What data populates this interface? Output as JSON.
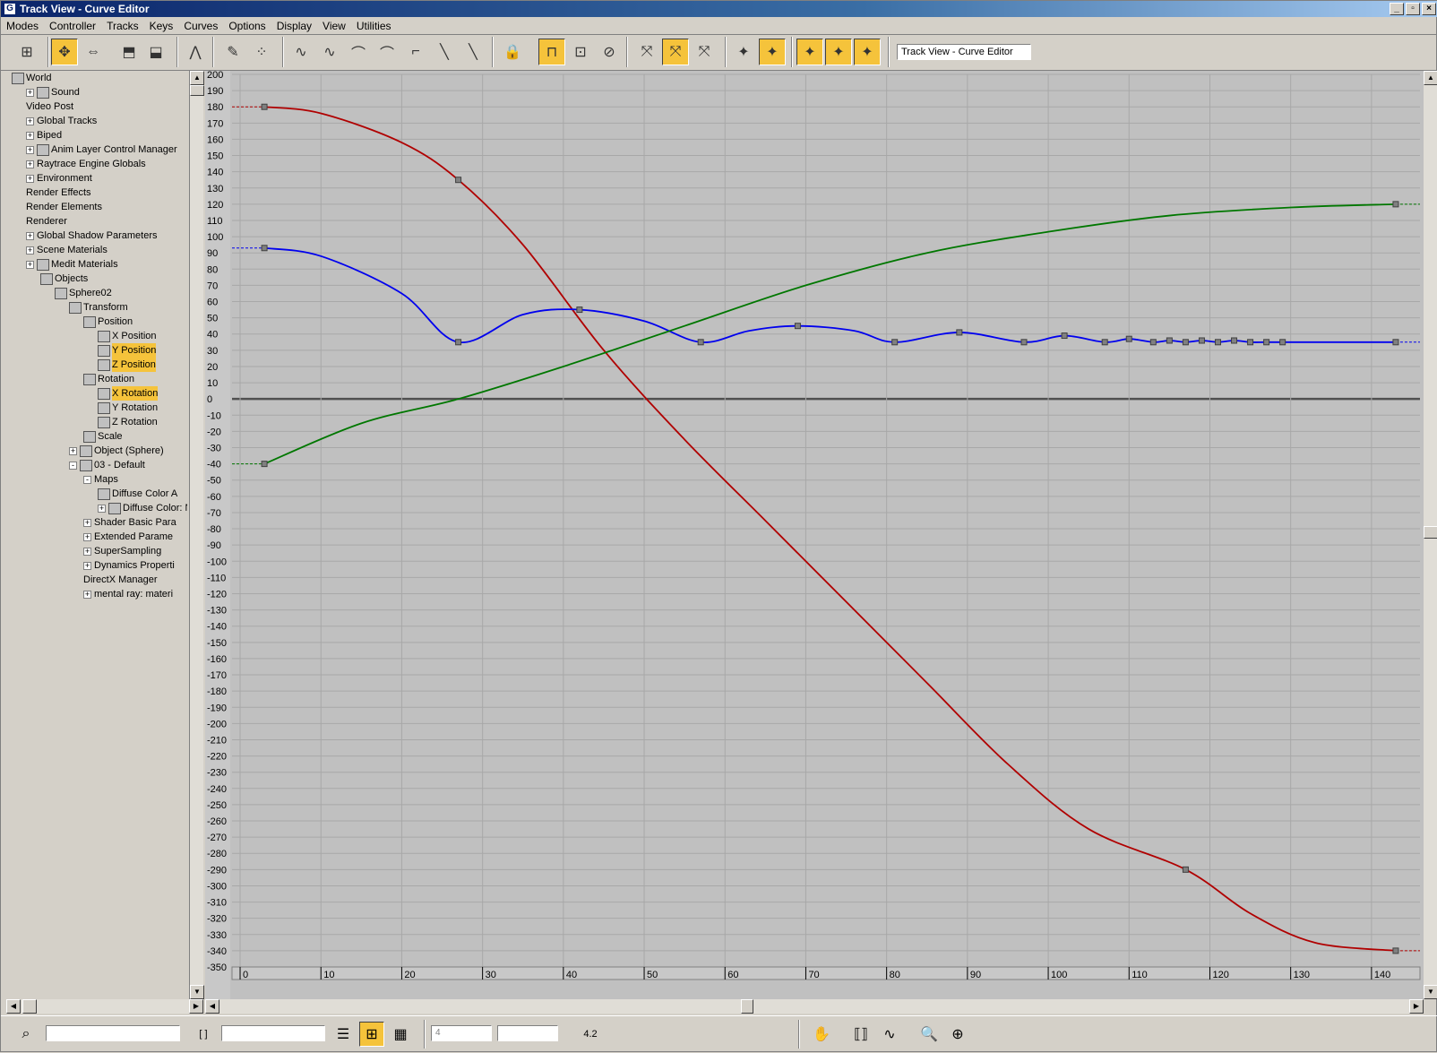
{
  "window": {
    "title": "Track View - Curve Editor",
    "icon": "3ds-max-icon"
  },
  "menu": [
    "Modes",
    "Controller",
    "Tracks",
    "Keys",
    "Curves",
    "Options",
    "Display",
    "View",
    "Utilities"
  ],
  "toolbar": {
    "title_field": "Track View - Curve Editor"
  },
  "tree": {
    "items": [
      {
        "label": "World",
        "depth": 0,
        "icon": "world-icon",
        "expander": ""
      },
      {
        "label": "Sound",
        "depth": 1,
        "icon": "sound-icon",
        "expander": "+"
      },
      {
        "label": "Video Post",
        "depth": 1,
        "icon": "",
        "expander": ""
      },
      {
        "label": "Global Tracks",
        "depth": 1,
        "icon": "",
        "expander": "+"
      },
      {
        "label": "Biped",
        "depth": 1,
        "icon": "",
        "expander": "+"
      },
      {
        "label": "Anim Layer Control Manager",
        "depth": 1,
        "icon": "layer-icon",
        "expander": "+"
      },
      {
        "label": "Raytrace Engine Globals",
        "depth": 1,
        "icon": "",
        "expander": "+"
      },
      {
        "label": "Environment",
        "depth": 1,
        "icon": "",
        "expander": "+"
      },
      {
        "label": "Render Effects",
        "depth": 1,
        "icon": "",
        "expander": ""
      },
      {
        "label": "Render Elements",
        "depth": 1,
        "icon": "",
        "expander": ""
      },
      {
        "label": "Renderer",
        "depth": 1,
        "icon": "",
        "expander": ""
      },
      {
        "label": "Global Shadow Parameters",
        "depth": 1,
        "icon": "",
        "expander": "+"
      },
      {
        "label": "Scene Materials",
        "depth": 1,
        "icon": "",
        "expander": "+"
      },
      {
        "label": "Medit Materials",
        "depth": 1,
        "icon": "material-icon",
        "expander": "+"
      },
      {
        "label": "Objects",
        "depth": 2,
        "icon": "objects-icon",
        "expander": ""
      },
      {
        "label": "Sphere02",
        "depth": 3,
        "icon": "sphere-icon",
        "expander": ""
      },
      {
        "label": "Transform",
        "depth": 4,
        "icon": "transform-icon",
        "expander": ""
      },
      {
        "label": "Position",
        "depth": 5,
        "icon": "position-icon",
        "expander": ""
      },
      {
        "label": "X Position",
        "depth": 6,
        "icon": "curve-track-icon",
        "expander": ""
      },
      {
        "label": "Y Position",
        "depth": 6,
        "icon": "curve-track-icon",
        "expander": "",
        "selected": true
      },
      {
        "label": "Z Position",
        "depth": 6,
        "icon": "curve-track-icon",
        "expander": "",
        "selected": true
      },
      {
        "label": "Rotation",
        "depth": 5,
        "icon": "rotation-icon",
        "expander": ""
      },
      {
        "label": "X Rotation",
        "depth": 6,
        "icon": "curve-track-icon",
        "expander": "",
        "selected": true
      },
      {
        "label": "Y Rotation",
        "depth": 6,
        "icon": "curve-track-icon",
        "expander": ""
      },
      {
        "label": "Z Rotation",
        "depth": 6,
        "icon": "curve-track-icon",
        "expander": ""
      },
      {
        "label": "Scale",
        "depth": 5,
        "icon": "scale-icon",
        "expander": ""
      },
      {
        "label": "Object (Sphere)",
        "depth": 4,
        "icon": "object-icon",
        "expander": "+"
      },
      {
        "label": "03 - Default",
        "depth": 4,
        "icon": "material-icon",
        "expander": "-"
      },
      {
        "label": "Maps",
        "depth": 5,
        "icon": "",
        "expander": "-"
      },
      {
        "label": "Diffuse Color A",
        "depth": 6,
        "icon": "curve-track-icon",
        "expander": ""
      },
      {
        "label": "Diffuse Color: N",
        "depth": 6,
        "icon": "map-icon",
        "expander": "+"
      },
      {
        "label": "Shader Basic Para",
        "depth": 5,
        "icon": "",
        "expander": "+"
      },
      {
        "label": "Extended Parame",
        "depth": 5,
        "icon": "",
        "expander": "+"
      },
      {
        "label": "SuperSampling",
        "depth": 5,
        "icon": "",
        "expander": "+"
      },
      {
        "label": "Dynamics Properti",
        "depth": 5,
        "icon": "",
        "expander": "+"
      },
      {
        "label": "DirectX Manager",
        "depth": 5,
        "icon": "",
        "expander": ""
      },
      {
        "label": "mental ray: materi",
        "depth": 5,
        "icon": "",
        "expander": "+"
      }
    ]
  },
  "statusbar": {
    "frame_field": "4",
    "value_field": "",
    "zoom_value": "4.2"
  },
  "colors": {
    "x_curve": "#b00000",
    "y_curve": "#0000ee",
    "z_curve": "#007700",
    "highlight": "#f5c33b",
    "graph_bg": "#c0c0c0"
  },
  "chart_data": {
    "type": "line",
    "title": "",
    "xlabel": "",
    "ylabel": "",
    "xlim": [
      -1,
      146
    ],
    "ylim": [
      -350,
      200
    ],
    "x_ticks": [
      0,
      10,
      20,
      30,
      40,
      50,
      60,
      70,
      80,
      90,
      100,
      110,
      120,
      130,
      140
    ],
    "y_ticks": [
      200,
      190,
      180,
      170,
      160,
      150,
      140,
      130,
      120,
      110,
      100,
      90,
      80,
      70,
      60,
      50,
      40,
      30,
      20,
      10,
      0,
      -10,
      -20,
      -30,
      -40,
      -50,
      -60,
      -70,
      -80,
      -90,
      -100,
      -110,
      -120,
      -130,
      -140,
      -150,
      -160,
      -170,
      -180,
      -190,
      -200,
      -210,
      -220,
      -230,
      -240,
      -250,
      -260,
      -270,
      -280,
      -290,
      -300,
      -310,
      -320,
      -330,
      -340,
      -350
    ],
    "grid": true,
    "series": [
      {
        "color": "#b00000",
        "x": [
          3,
          10,
          20,
          27,
          35,
          45,
          55,
          65,
          75,
          85,
          95,
          105,
          117,
          125,
          133,
          143
        ],
        "y": [
          180,
          176,
          158,
          135,
          95,
          30,
          -25,
          -75,
          -125,
          -175,
          -225,
          -265,
          -290,
          -317,
          -335,
          -340
        ],
        "keys_x": [
          3,
          27,
          117,
          143
        ],
        "keys_y": [
          180,
          135,
          -290,
          -340
        ]
      },
      {
        "color": "#0000ee",
        "x": [
          3,
          10,
          20,
          27,
          35,
          42,
          50,
          57,
          63,
          69,
          76,
          81,
          89,
          97,
          102,
          107,
          110,
          113,
          115,
          117,
          119,
          121,
          123,
          125,
          127,
          129,
          143
        ],
        "y": [
          93,
          88,
          65,
          35,
          52,
          55,
          48,
          35,
          42,
          45,
          42,
          35,
          41,
          35,
          39,
          35,
          37,
          35,
          36,
          35,
          36,
          35,
          36,
          35,
          35,
          35,
          35
        ],
        "keys_x": [
          3,
          27,
          42,
          57,
          69,
          81,
          89,
          97,
          102,
          107,
          110,
          113,
          115,
          117,
          119,
          121,
          123,
          125,
          127,
          129,
          143
        ],
        "keys_y": [
          93,
          35,
          55,
          35,
          45,
          35,
          41,
          35,
          39,
          35,
          37,
          35,
          36,
          35,
          36,
          35,
          36,
          35,
          35,
          35,
          35
        ]
      },
      {
        "color": "#007700",
        "x": [
          3,
          15,
          27,
          40,
          55,
          70,
          85,
          100,
          115,
          130,
          143
        ],
        "y": [
          -40,
          -15,
          0,
          20,
          45,
          70,
          90,
          103,
          113,
          118,
          120
        ],
        "keys_x": [
          3,
          143
        ],
        "keys_y": [
          -40,
          120
        ]
      }
    ]
  }
}
